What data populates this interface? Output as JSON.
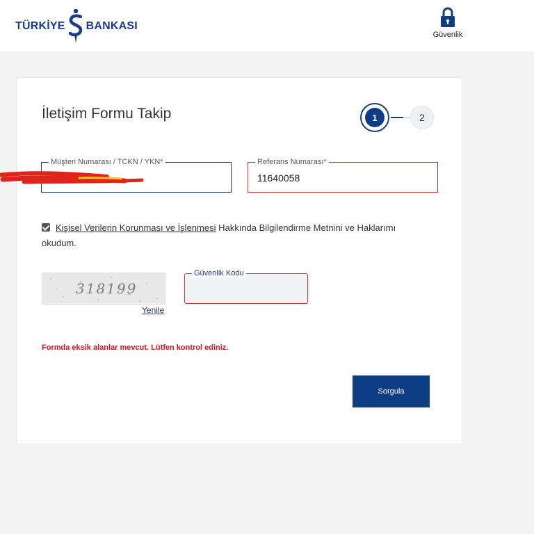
{
  "header": {
    "logo_left": "TÜRKİYE",
    "logo_right": "BANKASI",
    "security_label": "Güvenlik"
  },
  "form": {
    "title": "İletişim Formu Takip",
    "steps": [
      "1",
      "2"
    ],
    "musteri": {
      "label": "Müşteri Numarası / TCKN / YKN",
      "required": "*",
      "value": ""
    },
    "referans": {
      "label": "Referans Numarası",
      "required": "*",
      "value": "11640058"
    },
    "consent": {
      "link": "Kişisel Verilerin Korunması ve İşlenmesi",
      "text": " Hakkında Bilgilendirme Metnini ve Haklarımı okudum."
    },
    "captcha_text": "318199",
    "refresh_label": "Yenile",
    "security_code_label": "Güvenlik Kodu",
    "error": "Formda eksik alanlar mevcut. Lütfen kontrol ediniz.",
    "submit_label": "Sorgula"
  },
  "colors": {
    "brand": "#0f3d84",
    "error": "#e0303a"
  }
}
